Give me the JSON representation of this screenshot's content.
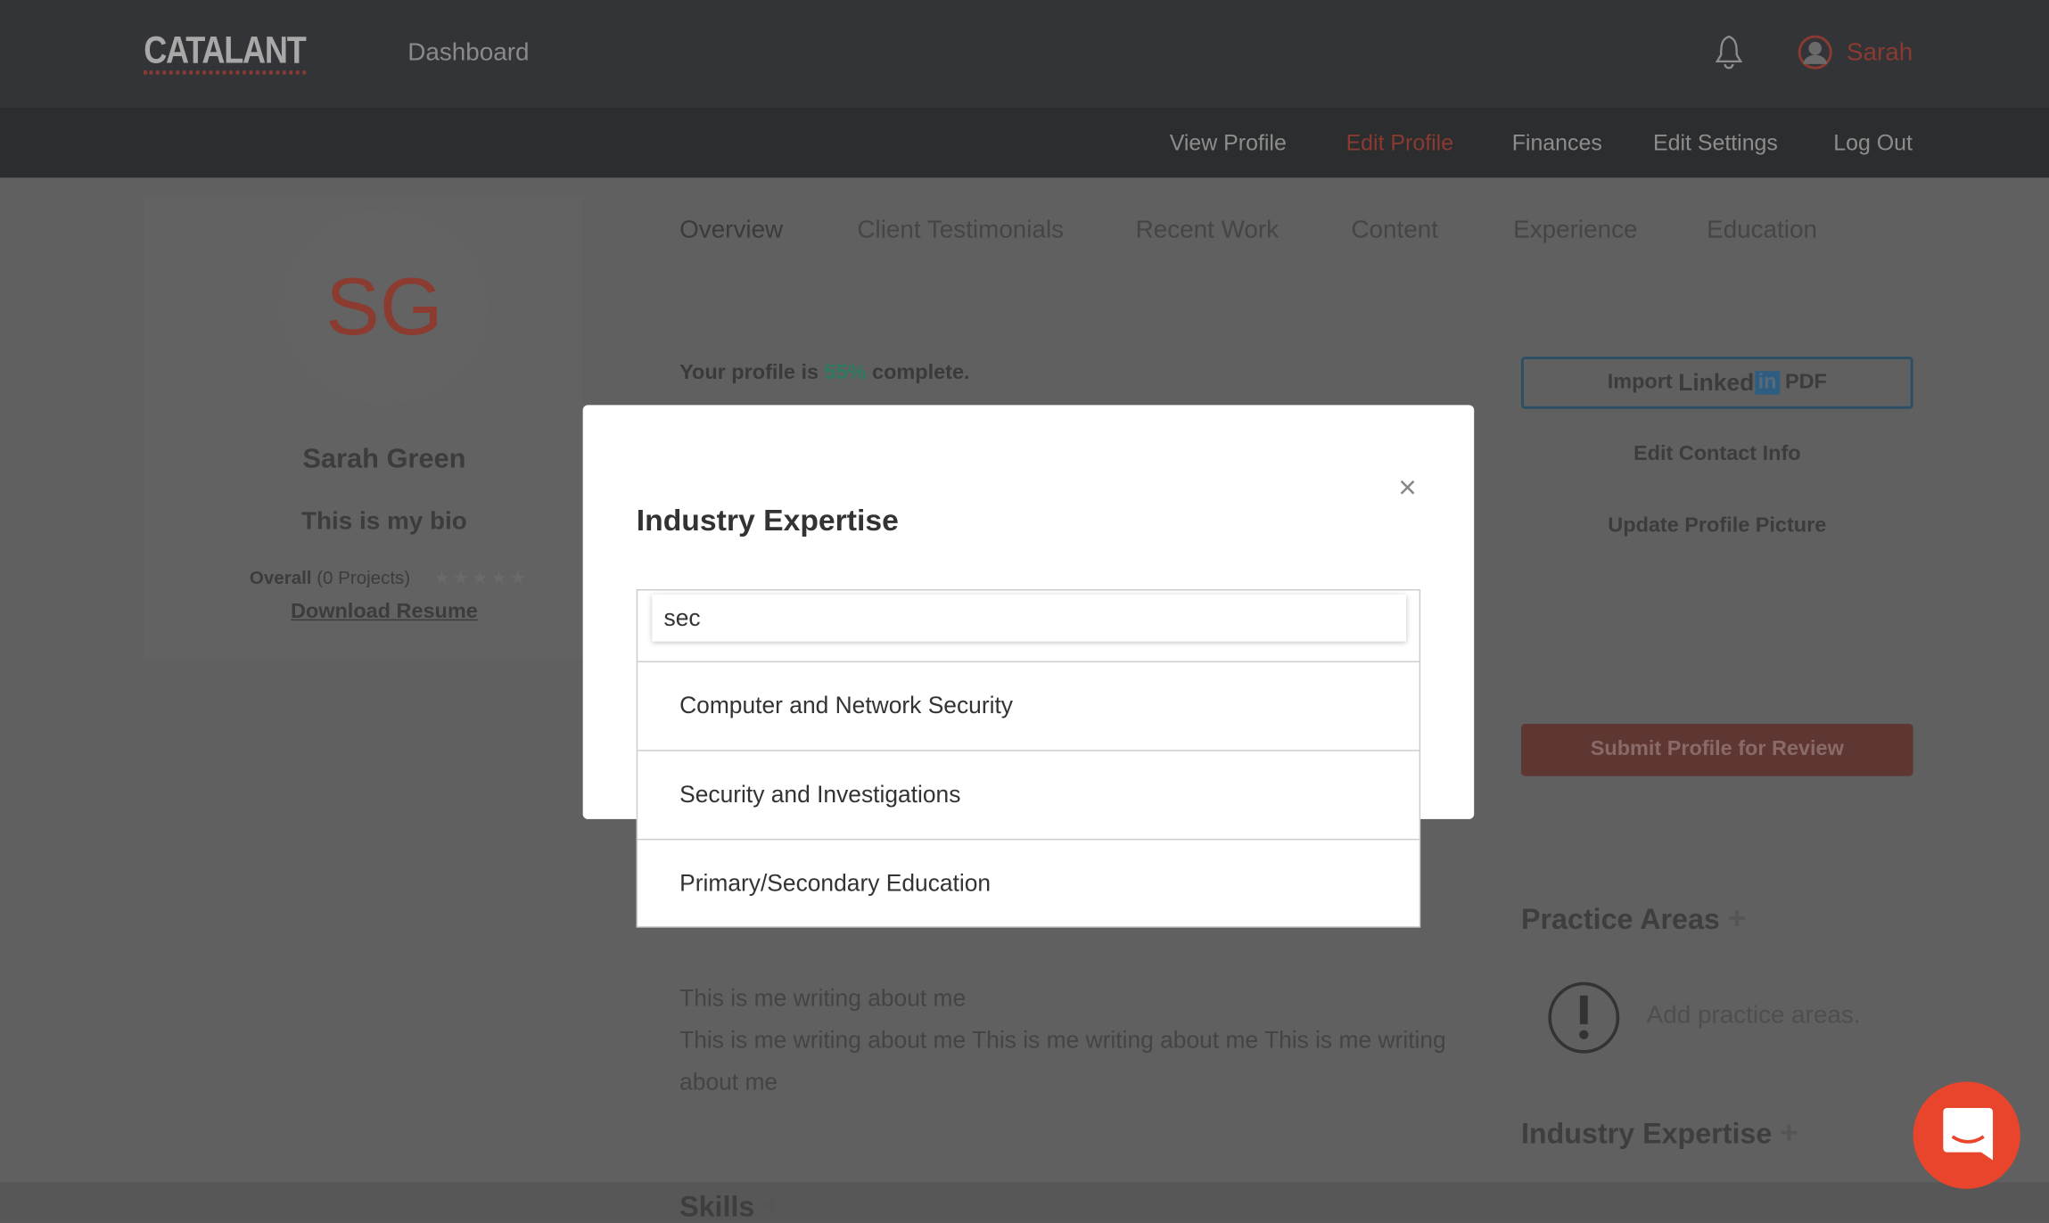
{
  "header": {
    "logo": "CATALANT",
    "dashboard": "Dashboard",
    "user_name": "Sarah"
  },
  "subnav": [
    "View Profile",
    "Edit Profile",
    "Finances",
    "Edit Settings",
    "Log Out"
  ],
  "tabs": [
    "Overview",
    "Client Testimonials",
    "Recent Work",
    "Content",
    "Experience",
    "Education"
  ],
  "profile": {
    "initials": "SG",
    "name": "Sarah Green",
    "bio": "This is my bio",
    "rating_label": "Overall",
    "rating_count": "(0 Projects)",
    "stars": 0,
    "download": "Download Resume"
  },
  "completion": {
    "prefix": "Your profile is",
    "percent": "55%",
    "suffix": "complete."
  },
  "actions": {
    "import_prefix": "Import",
    "import_brand": "Linked",
    "import_in": "in",
    "import_suffix": "PDF",
    "edit_contact": "Edit Contact Info",
    "update_picture": "Update Profile Picture",
    "submit": "Submit Profile for Review"
  },
  "sections": {
    "practice_title": "Practice Areas",
    "practice_empty": "Add practice areas.",
    "industry_title": "Industry Expertise",
    "skills_title": "Skills"
  },
  "about": {
    "line1": "This is me writing about me",
    "line2": " This is me writing about me This is me writing about me This is me writing",
    "line3": "about me"
  },
  "modal": {
    "title": "Industry Expertise",
    "search_value": "sec",
    "options": [
      "Computer and Network Security",
      "Security and Investigations",
      "Primary/Secondary Education"
    ]
  },
  "colors": {
    "accent": "#e8452c",
    "green": "#2e7a5e",
    "linkedin": "#2d5d80"
  }
}
